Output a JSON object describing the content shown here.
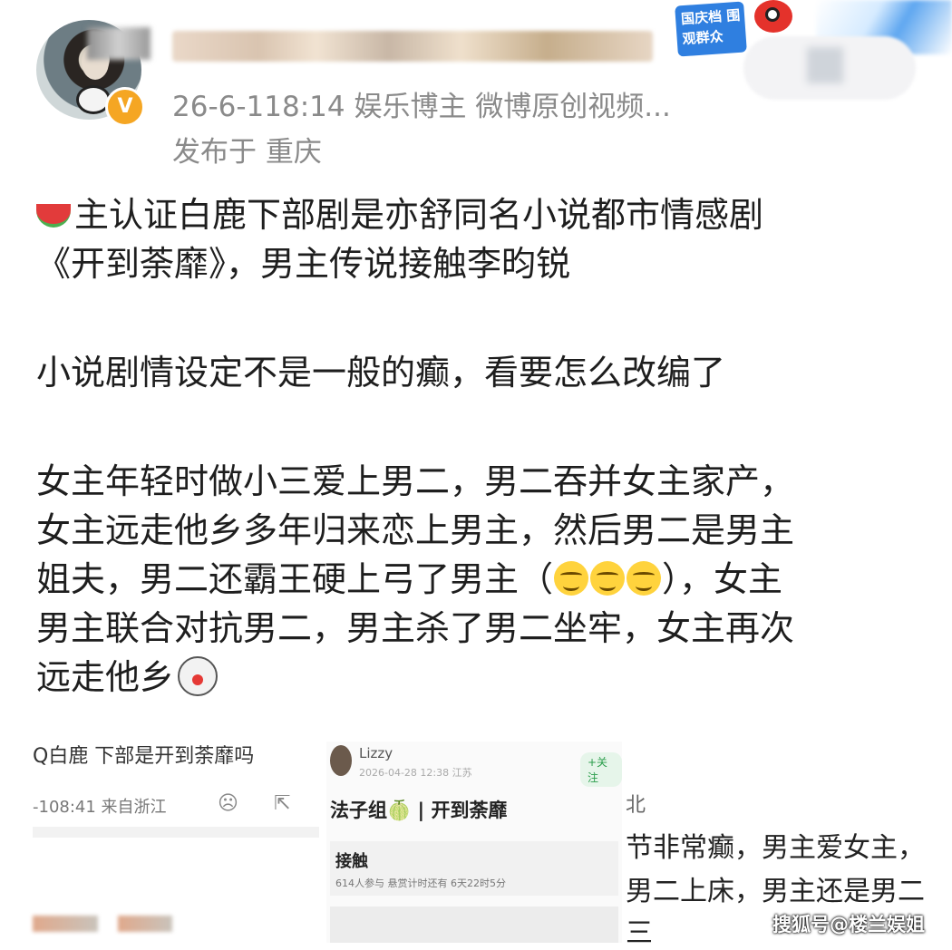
{
  "header": {
    "meta_line1": "26-6-118:14  娱乐博主 微博原创视频...",
    "meta_line2": "发布于 重庆",
    "verify_badge": "V",
    "sticker_text": "国庆档 围观群众"
  },
  "post": {
    "para1": [
      "主认证白鹿下部剧是亦舒同名小说都市情感剧",
      "《开到荼靡》，男主传说接触李昀锐"
    ],
    "para2": "小说剧情设定不是一般的癫，看要怎么改编了",
    "para3": [
      "女主年轻时做小三爱上男二，男二吞并女主家产，",
      "女主远走他乡多年归来恋上男主，然后男二是男主",
      "姐夫，男二还霸王硬上弓了男主（",
      "），女主",
      "男主联合对抗男二，男主杀了男二坐牢，女主再次",
      "远走他乡"
    ]
  },
  "screenshot1": {
    "question": "Q白鹿 下部是开到荼靡吗",
    "time": "-108:41 来自浙江"
  },
  "screenshot2": {
    "username": "Lizzy",
    "subline": "2026-04-28 12:38 江苏",
    "follow": "+关注",
    "topic": "法子组🍈 | 开到荼靡",
    "card_title": "接触",
    "card_meta": "614人参与  悬赏计时还有 6天22时5分"
  },
  "screenshot3": {
    "lines": [
      "北",
      "节非常癫，男主爱女主，",
      "男二上床，男主还是男二",
      "三"
    ]
  },
  "watermark": "搜狐号@楼兰娱姐"
}
